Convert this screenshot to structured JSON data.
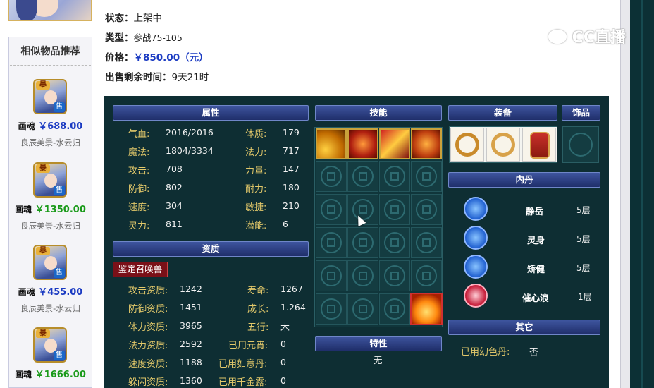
{
  "item": {
    "name_partial": "",
    "status_label": "状态：",
    "status_value": "上架中",
    "type_label": "类型：",
    "type_value": "参战75-105",
    "price_label": "价格：",
    "price_value": "￥850.00（元）",
    "time_label": "出售剩余时间：",
    "time_value": "9天21时"
  },
  "watermark": "CC直播",
  "sidebar": {
    "title": "相似物品推荐",
    "items": [
      {
        "name": "画魂",
        "price": "￥688.00",
        "price_color": "#1a3ac2",
        "server": "良辰美景-水云归",
        "tag_top": "暴",
        "tag_sell": "售"
      },
      {
        "name": "画魂",
        "price": "￥1350.00",
        "price_color": "#1a9a1a",
        "server": "良辰美景-水云归",
        "tag_top": "暴",
        "tag_sell": "售"
      },
      {
        "name": "画魂",
        "price": "￥455.00",
        "price_color": "#1a3ac2",
        "server": "良辰美景-水云归",
        "tag_top": "暴",
        "tag_sell": "售"
      },
      {
        "name": "画魂",
        "price": "￥1666.00",
        "price_color": "#1a9a1a",
        "server": "",
        "tag_top": "暴",
        "tag_sell": "售"
      }
    ]
  },
  "panel": {
    "attr_header": "属性",
    "skill_header": "技能",
    "equip_header": "装备",
    "accessory_header": "饰品",
    "neidan_header": "内丹",
    "aptitude_header": "资质",
    "trait_header": "特性",
    "other_header": "其它",
    "identify_button": "鉴定召唤兽",
    "trait_value": "无",
    "attributes_left": [
      {
        "label": "气血:",
        "value": "2016/2016"
      },
      {
        "label": "魔法:",
        "value": "1804/3334"
      },
      {
        "label": "攻击:",
        "value": "708"
      },
      {
        "label": "防御:",
        "value": "802"
      },
      {
        "label": "速度:",
        "value": "304"
      },
      {
        "label": "灵力:",
        "value": "811"
      }
    ],
    "attributes_right": [
      {
        "label": "体质:",
        "value": "179"
      },
      {
        "label": "法力:",
        "value": "717"
      },
      {
        "label": "力量:",
        "value": "147"
      },
      {
        "label": "耐力:",
        "value": "180"
      },
      {
        "label": "敏捷:",
        "value": "210"
      },
      {
        "label": "潜能:",
        "value": "6"
      }
    ],
    "aptitude_left": [
      {
        "label": "攻击资质:",
        "value": "1242"
      },
      {
        "label": "防御资质:",
        "value": "1451"
      },
      {
        "label": "体力资质:",
        "value": "3965"
      },
      {
        "label": "法力资质:",
        "value": "2592"
      },
      {
        "label": "速度资质:",
        "value": "1188"
      },
      {
        "label": "躲闪资质:",
        "value": "1360"
      }
    ],
    "aptitude_right": [
      {
        "label": "寿命:",
        "value": "1267"
      },
      {
        "label": "成长:",
        "value": "1.264"
      },
      {
        "label": "五行:",
        "value": "木"
      },
      {
        "label": "已用元宵:",
        "value": "0"
      },
      {
        "label": "已用如意丹:",
        "value": "0"
      },
      {
        "label": "已用千金露:",
        "value": "0"
      }
    ],
    "neidan": [
      {
        "name": "静岳",
        "level": "5层",
        "color": "#2a6fd6"
      },
      {
        "name": "灵身",
        "level": "5层",
        "color": "#2a6fd6"
      },
      {
        "name": "矫健",
        "level": "5层",
        "color": "#2a6fd6"
      },
      {
        "name": "催心浪",
        "level": "1层",
        "color": "#c8203c"
      }
    ],
    "other_label": "已用幻色丹:",
    "other_value": "否"
  }
}
